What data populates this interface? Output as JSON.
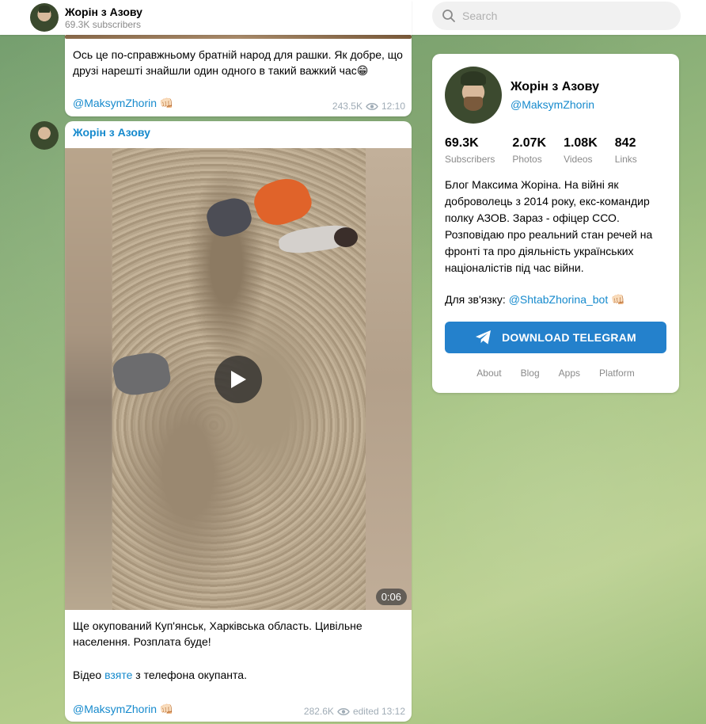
{
  "header": {
    "title": "Жорін з Азову",
    "subscribers": "69.3K subscribers",
    "search_placeholder": "Search"
  },
  "messages": [
    {
      "text_lines": [
        "Ось це по-справжньому братній народ для рашки. Як добре, що",
        "друзі нарешті знайшли один одного в такий важкий час😁"
      ],
      "signature": "@MaksymZhorin 👊🏻",
      "views": "243.5K",
      "time": "12:10"
    },
    {
      "author": "Жорін з Азову",
      "video_duration": "0:06",
      "text_line1": "Ще окупований Куп'янськ, Харківська область. Цивільне",
      "text_line2": "населення. Розплата буде!",
      "text_line3_before": "Відео ",
      "text_line3_link": "взяте",
      "text_line3_after": " з телефона окупанта.",
      "signature": "@MaksymZhorin 👊🏻",
      "views": "282.6K",
      "time": "edited  13:12"
    }
  ],
  "channel_card": {
    "title": "Жорін з Азову",
    "handle": "@MaksymZhorin",
    "stats": [
      {
        "value": "69.3K",
        "label": "Subscribers"
      },
      {
        "value": "2.07K",
        "label": "Photos"
      },
      {
        "value": "1.08K",
        "label": "Videos"
      },
      {
        "value": "842",
        "label": "Links"
      }
    ],
    "description_lines": [
      "Блог Максима Жоріна. На війні як",
      "доброволець з 2014 року, екс-командир",
      "полку АЗОВ. Зараз - офіцер ССО.",
      "Розповідаю про реальний стан речей на",
      "фронті та про діяльність українських",
      "націоналістів під час війни."
    ],
    "contact_label": "Для зв'язку: ",
    "contact_link": "@ShtabZhorina_bot 👊🏻",
    "download_button": "DOWNLOAD TELEGRAM",
    "footer_links": [
      "About",
      "Blog",
      "Apps",
      "Platform"
    ]
  },
  "colors": {
    "accent": "#168acd",
    "button": "#2481cc"
  }
}
